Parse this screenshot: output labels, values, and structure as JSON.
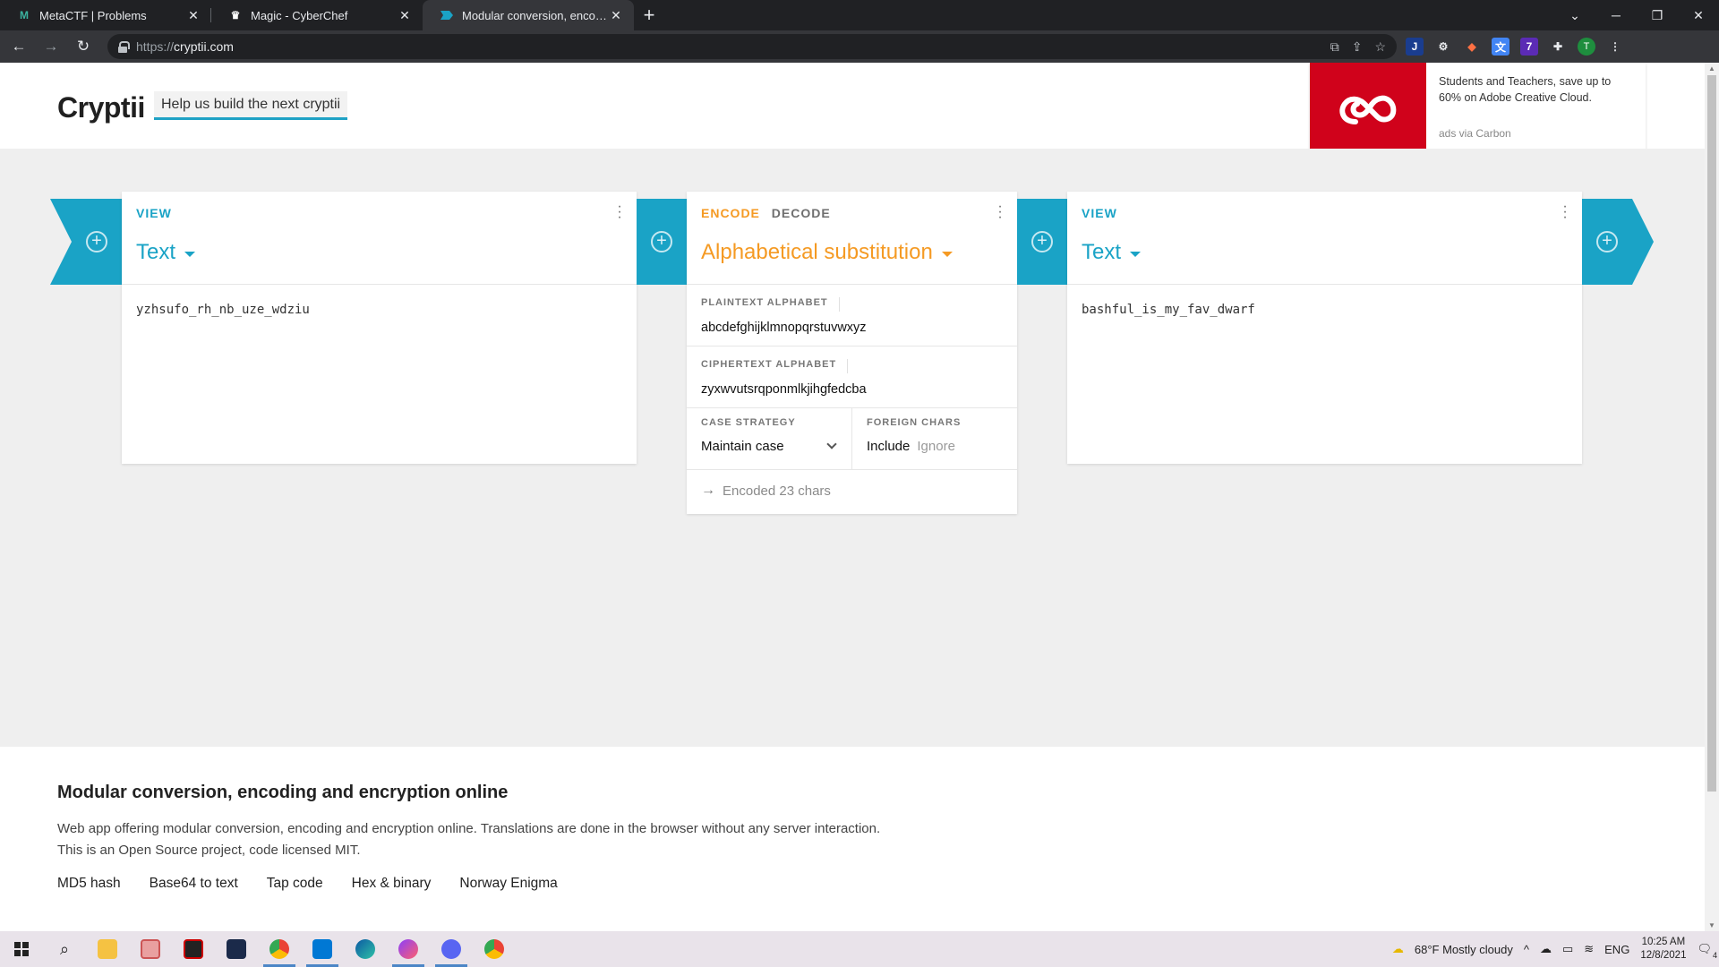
{
  "browser": {
    "tabs": [
      {
        "title": "MetaCTF | Problems",
        "favicon": "metactf-icon"
      },
      {
        "title": "Magic - CyberChef",
        "favicon": "cyberchef-icon"
      },
      {
        "title": "Modular conversion, encoding and encryption online",
        "favicon": "cryptii-icon"
      }
    ],
    "url_scheme": "https://",
    "url_host": "cryptii.com"
  },
  "header": {
    "brand": "Cryptii",
    "help_link": "Help us build the next cryptii"
  },
  "ad": {
    "text": "Students and Teachers, save up to 60% on Adobe Creative Cloud.",
    "via": "ads via Carbon"
  },
  "bricks": {
    "left": {
      "kind": "VIEW",
      "title": "Text",
      "content": "yzhsufo_rh_nb_uze_wdziu"
    },
    "middle": {
      "encode": "ENCODE",
      "decode": "DECODE",
      "title": "Alphabetical substitution",
      "plaintext_label": "PLAINTEXT ALPHABET",
      "plaintext_value": "abcdefghijklmnopqrstuvwxyz",
      "ciphertext_label": "CIPHERTEXT ALPHABET",
      "ciphertext_value": "zyxwvutsrqponmlkjihgfedcba",
      "case_label": "CASE STRATEGY",
      "case_value": "Maintain case",
      "foreign_label": "FOREIGN CHARS",
      "foreign_include": "Include",
      "foreign_ignore": "Ignore",
      "status": "Encoded 23 chars"
    },
    "right": {
      "kind": "VIEW",
      "title": "Text",
      "content": "bashful_is_my_fav_dwarf"
    }
  },
  "footer": {
    "heading": "Modular conversion, encoding and encryption online",
    "description": "Web app offering modular conversion, encoding and encryption online. Translations are done in the browser without any server interaction. This is an Open Source project, code licensed MIT.",
    "links": [
      "MD5 hash",
      "Base64 to text",
      "Tap code",
      "Hex & binary",
      "Norway Enigma"
    ]
  },
  "taskbar": {
    "weather": "68°F  Mostly cloudy",
    "lang": "ENG",
    "time": "10:25 AM",
    "date": "12/8/2021",
    "notifications": "4"
  },
  "colors": {
    "accent_teal": "#1aa3c6",
    "accent_orange": "#f59a23",
    "ad_red": "#d0021b"
  }
}
